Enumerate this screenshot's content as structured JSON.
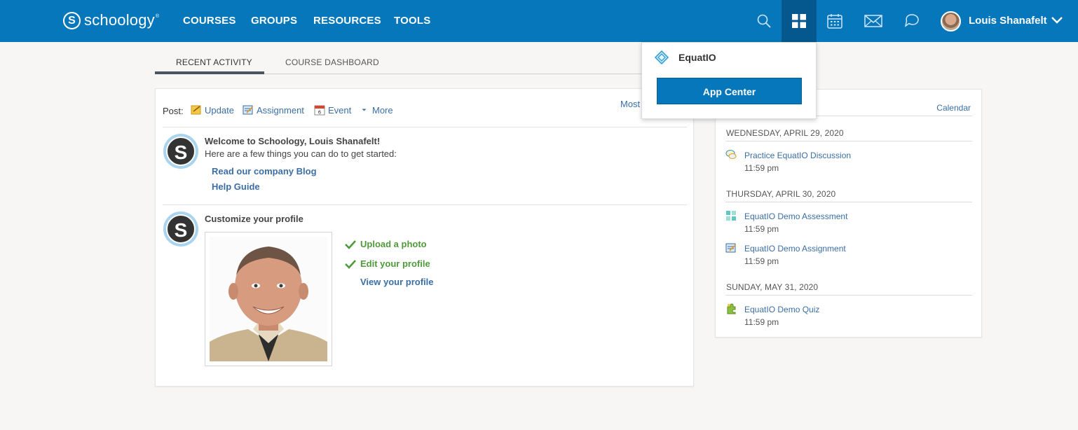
{
  "brand": {
    "name": "schoology",
    "mark": "S",
    "tm": "®"
  },
  "nav": {
    "items": [
      "COURSES",
      "GROUPS",
      "RESOURCES",
      "TOOLS"
    ],
    "user_name": "Louis Shanafelt"
  },
  "tabs": [
    "RECENT ACTIVITY",
    "COURSE DASHBOARD"
  ],
  "post": {
    "label": "Post:",
    "actions": [
      "Update",
      "Assignment",
      "Event",
      "More"
    ],
    "event_day": "6",
    "sort_link": "Most"
  },
  "feed": {
    "welcome_title": "Welcome to Schoology, Louis Shanafelt!",
    "welcome_sub": "Here are a few things you can do to get started:",
    "links": [
      "Read our company Blog",
      "Help Guide"
    ],
    "customize_title": "Customize your profile",
    "profile_tasks": [
      "Upload a photo",
      "Edit your profile",
      "View your profile"
    ]
  },
  "upcoming": {
    "calendar_link": "Calendar",
    "days": [
      {
        "date": "WEDNESDAY, APRIL 29, 2020",
        "events": [
          {
            "name": "Practice EquatIO Discussion",
            "time": "11:59 pm",
            "icon": "discussion-icon"
          }
        ]
      },
      {
        "date": "THURSDAY, APRIL 30, 2020",
        "events": [
          {
            "name": "EquatIO Demo Assessment",
            "time": "11:59 pm",
            "icon": "assessment-icon"
          },
          {
            "name": "EquatIO Demo Assignment",
            "time": "11:59 pm",
            "icon": "assignment-icon"
          }
        ]
      },
      {
        "date": "SUNDAY, MAY 31, 2020",
        "events": [
          {
            "name": "EquatIO Demo Quiz",
            "time": "11:59 pm",
            "icon": "quiz-icon"
          }
        ]
      }
    ]
  },
  "apps_dropdown": {
    "app_name": "EquatIO",
    "button": "App Center"
  },
  "colors": {
    "header": "#0677ba",
    "header_active": "#05588d",
    "link": "#3a6ea5",
    "done": "#4e9a3a"
  }
}
